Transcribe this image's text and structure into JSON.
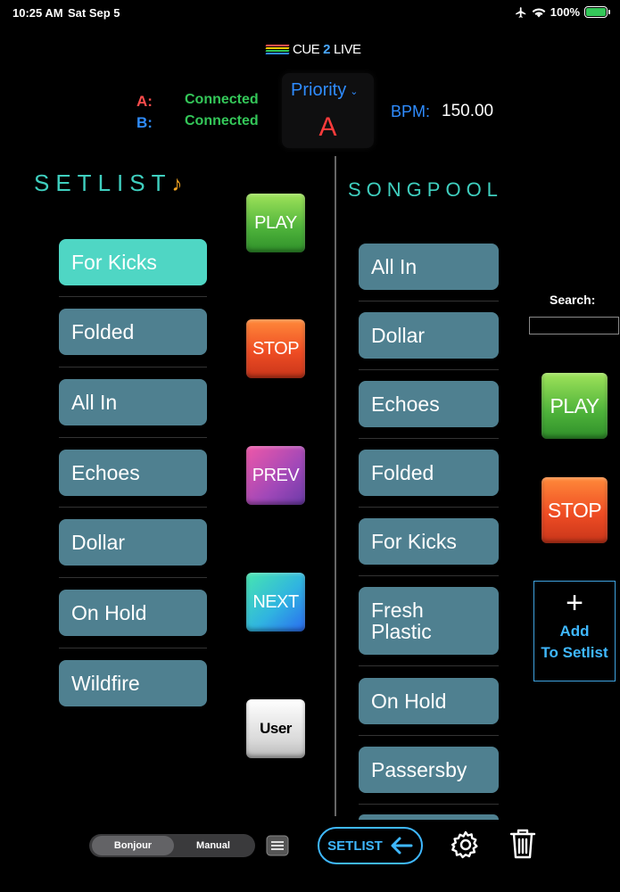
{
  "status_bar": {
    "time": "10:25 AM",
    "date": "Sat Sep 5",
    "battery_percent": "100%"
  },
  "logo": {
    "part1": "CUE",
    "part2": "2",
    "part3": "LIVE"
  },
  "connections": {
    "a_label": "A:",
    "a_status": "Connected",
    "b_label": "B:",
    "b_status": "Connected"
  },
  "priority": {
    "title": "Priority",
    "value": "A"
  },
  "bpm": {
    "label": "BPM:",
    "value": "150.00"
  },
  "setlist": {
    "title": "SETLIST",
    "items": [
      "For Kicks",
      "Folded",
      "All In",
      "Echoes",
      "Dollar",
      "On Hold",
      "Wildfire"
    ],
    "active_index": 0
  },
  "controls": {
    "play": "PLAY",
    "stop": "STOP",
    "prev": "PREV",
    "next": "NEXT",
    "user": "User"
  },
  "songpool": {
    "title": "SONGPOOL",
    "items": [
      "All In",
      "Dollar",
      "Echoes",
      "Folded",
      "For Kicks",
      "Fresh Plastic",
      "On Hold",
      "Passersby"
    ]
  },
  "search": {
    "label": "Search:",
    "value": "",
    "placeholder": ""
  },
  "pool_controls": {
    "play": "PLAY",
    "stop": "STOP"
  },
  "add_to_setlist": {
    "line1": "Add",
    "line2": "To Setlist"
  },
  "bottom": {
    "segment_options": [
      "Bonjour",
      "Manual"
    ],
    "segment_selected": "Bonjour",
    "setlist_button": "SETLIST"
  },
  "colors": {
    "accent_teal": "#3fcfbf",
    "song_button": "#4f8090",
    "song_button_active": "#4fd6c4",
    "connected_green": "#34c759",
    "link_blue": "#3fb8ff",
    "label_a_red": "#ff4d4d",
    "label_b_blue": "#2f8cff"
  }
}
